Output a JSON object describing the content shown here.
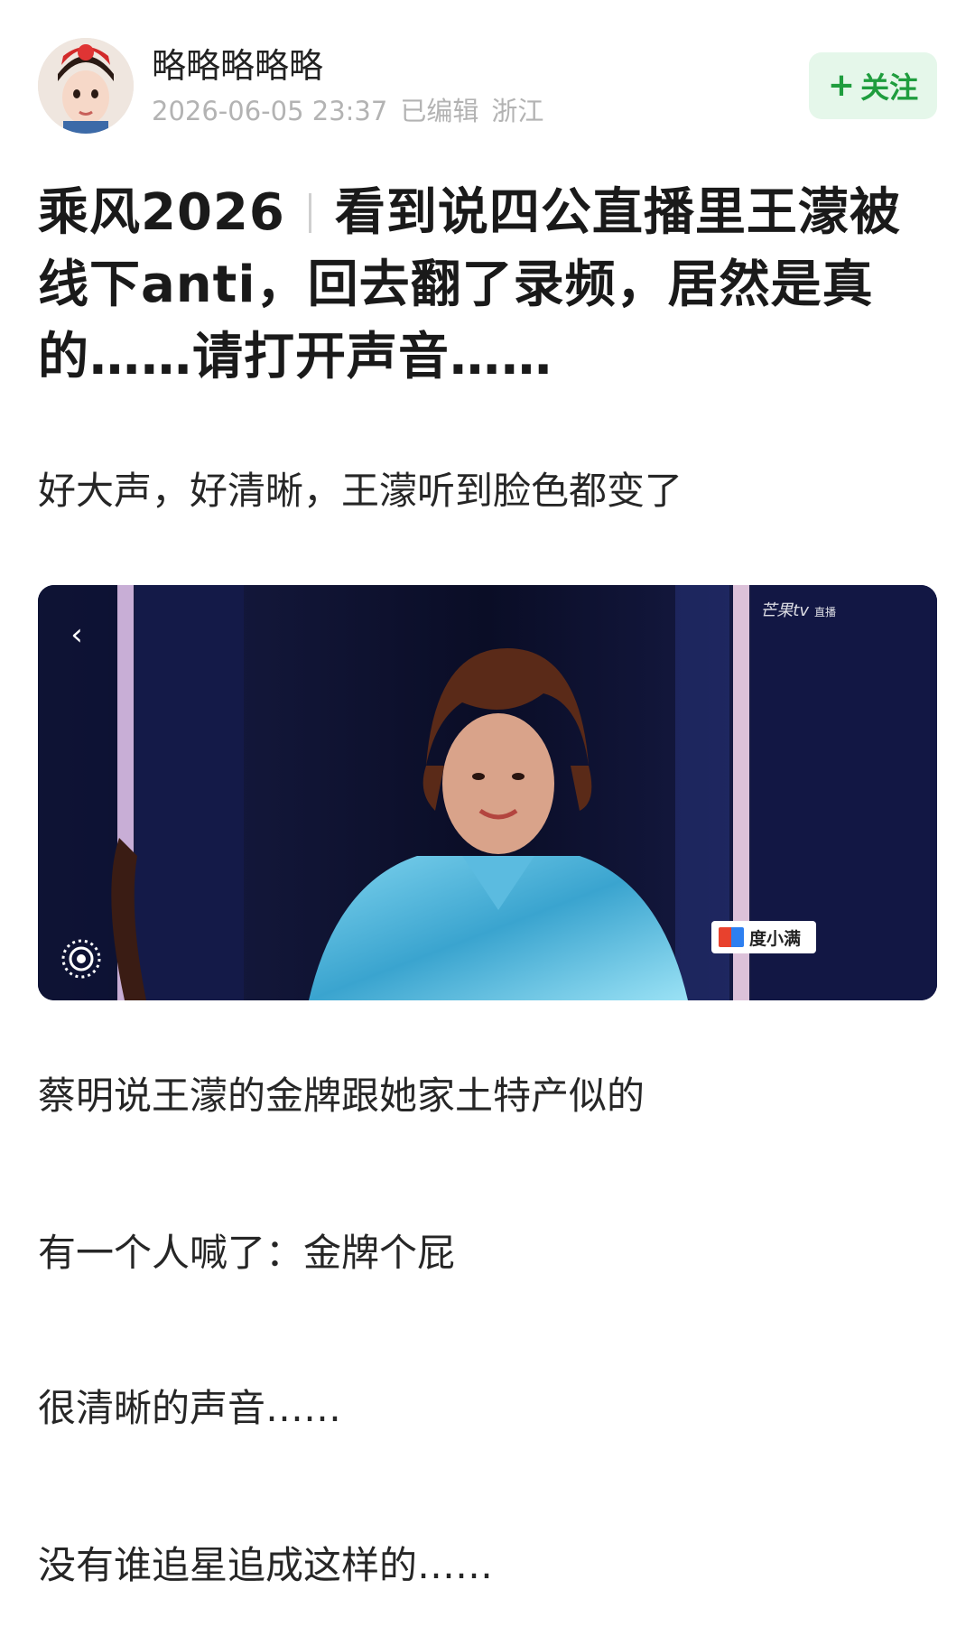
{
  "post": {
    "author": "略略略略略",
    "date": "2026-06-05 23:37",
    "edited": "已编辑",
    "location": "浙江",
    "follow_label": "关注",
    "title_tag": "乘风2026",
    "title_text": "看到说四公直播里王濛被线下anti，回去翻了录频，居然是真的……请打开声音……"
  },
  "body": {
    "p1": "好大声，好清晰，王濛听到脸色都变了",
    "p2": "蔡明说王濛的金牌跟她家土特产似的",
    "p3": "有一个人喊了：金牌个屁",
    "p4": "很清晰的声音……",
    "p5": "没有谁追星追成这样的……"
  },
  "video": {
    "brand": "芒果tv",
    "brand_sub": "直播",
    "sponsor": "度小满"
  },
  "icons": {
    "back": "chevron-left-icon",
    "live": "live-broadcast-icon",
    "plus": "plus-icon"
  },
  "colors": {
    "follow_bg": "#e5f7ea",
    "follow_text": "#1f9d3e",
    "meta_gray": "#b3b3b3"
  }
}
